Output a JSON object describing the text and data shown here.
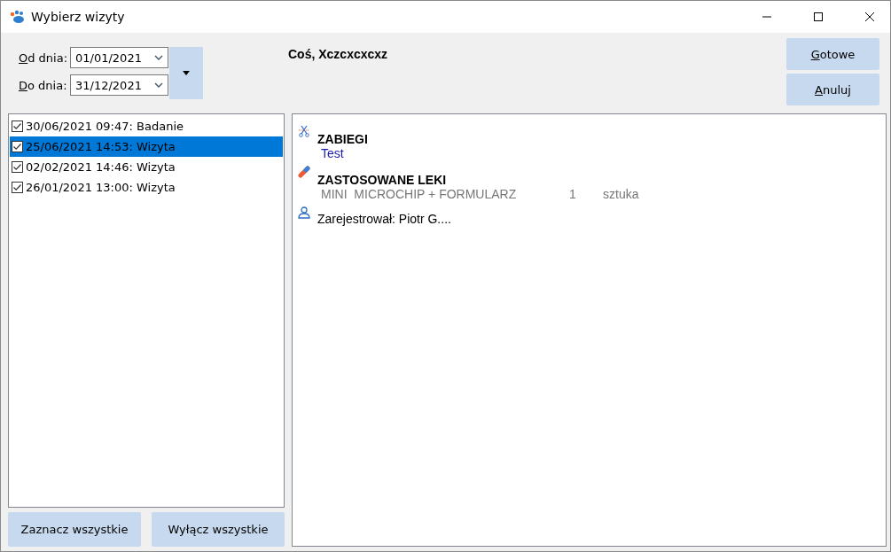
{
  "window": {
    "title": "Wybierz wizyty"
  },
  "filters": [
    {
      "label": "Od dnia:",
      "value": "01/01/2021"
    },
    {
      "label": "Do dnia:",
      "value": "31/12/2021"
    }
  ],
  "patient": "Coś, Xczcxcxcxz",
  "actions": [
    "Gotowe",
    "Anuluj"
  ],
  "visits": [
    {
      "label": "30/06/2021 09:47: Badanie",
      "checked": true,
      "selected": false
    },
    {
      "label": "25/06/2021 14:53: Wizyta",
      "checked": true,
      "selected": true
    },
    {
      "label": "02/02/2021 14:46: Wizyta",
      "checked": true,
      "selected": false
    },
    {
      "label": "26/01/2021 13:00: Wizyta",
      "checked": true,
      "selected": false
    }
  ],
  "list_buttons": [
    "Zaznacz wszystkie",
    "Wyłącz wszystkie"
  ],
  "details": {
    "procedures": {
      "heading": "ZABIEGI",
      "items": [
        "Test"
      ]
    },
    "drugs": {
      "heading": "ZASTOSOWANE LEKI",
      "items": [
        {
          "name": "MINI  MICROCHIP + FORMULARZ",
          "quantity": "1",
          "unit": "sztuka"
        }
      ]
    },
    "registered_by": "Zarejestrował: Piotr G...."
  }
}
